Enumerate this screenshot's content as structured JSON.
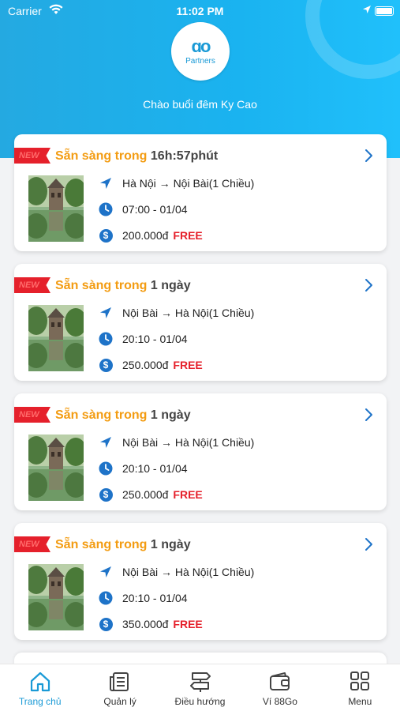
{
  "status_bar": {
    "carrier": "Carrier",
    "time": "11:02 PM"
  },
  "header": {
    "logo_mark": "ɑo",
    "logo_text": "Partners",
    "greeting": "Chào buổi đêm Ky Cao"
  },
  "colors": {
    "header_blue": "#1ab3f0",
    "accent_orange": "#f39c12",
    "free_red": "#e5202b",
    "icon_blue": "#1e73c8"
  },
  "cards": [
    {
      "badge": "NEW",
      "title_prefix": "Sẵn sàng trong",
      "availability": "16h:57phút",
      "route": "Hà Nội → Nội Bài(1 Chiều)",
      "time": "07:00 - 01/04",
      "price": "200.000đ",
      "price_tag": "FREE"
    },
    {
      "badge": "NEW",
      "title_prefix": "Sẵn sàng trong",
      "availability": "1 ngày",
      "route": "Nội Bài → Hà Nội(1 Chiều)",
      "time": "20:10 - 01/04",
      "price": "250.000đ",
      "price_tag": "FREE"
    },
    {
      "badge": "NEW",
      "title_prefix": "Sẵn sàng trong",
      "availability": "1 ngày",
      "route": "Nội Bài → Hà Nội(1 Chiều)",
      "time": "20:10 - 01/04",
      "price": "250.000đ",
      "price_tag": "FREE"
    },
    {
      "badge": "NEW",
      "title_prefix": "Sẵn sàng trong",
      "availability": "1 ngày",
      "route": "Nội Bài → Hà Nội(1 Chiều)",
      "time": "20:10 - 01/04",
      "price": "350.000đ",
      "price_tag": "FREE"
    }
  ],
  "tabbar": [
    {
      "label": "Trang chủ",
      "icon": "home-icon",
      "active": true
    },
    {
      "label": "Quản lý",
      "icon": "manage-icon",
      "active": false
    },
    {
      "label": "Điều hướng",
      "icon": "signpost-icon",
      "active": false
    },
    {
      "label": "Ví 88Go",
      "icon": "wallet-icon",
      "active": false
    },
    {
      "label": "Menu",
      "icon": "grid-menu-icon",
      "active": false
    }
  ]
}
